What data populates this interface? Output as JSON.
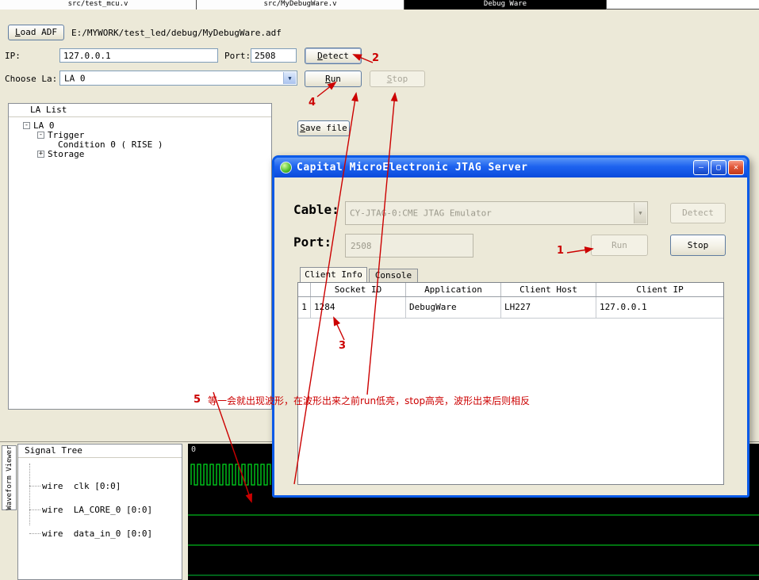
{
  "icons": {
    "collapse_glyph": "-",
    "expand_glyph": "+",
    "dropdown_arrow": "▼",
    "minimize_glyph": "—",
    "maximize_glyph": "▢",
    "close_glyph": "✕"
  },
  "colors": {
    "desktop_bg": "#ece9d8",
    "titlebar_blue": "#0a5ae8",
    "annotation_red": "#cc0000",
    "waveform_green": "#00d81f",
    "active_tab_bg": "#000000"
  },
  "editor_tabs": [
    {
      "label": "src/test_mcu.v",
      "active": false
    },
    {
      "label": "src/MyDebugWare.v",
      "active": false
    },
    {
      "label": "Debug Ware",
      "active": true
    }
  ],
  "main": {
    "load_adf_button": "Load ADF",
    "adf_path": "E:/MYWORK/test_led/debug/MyDebugWare.adf",
    "ip_label": "IP:",
    "ip_value": "127.0.0.1",
    "port_label": "Port:",
    "port_value": "2508",
    "detect_button": "Detect",
    "choose_la_label": "Choose La:",
    "choose_la_value": "LA 0",
    "run_button": "Run",
    "stop_button": "Stop",
    "save_file_button": "Save file",
    "la_list": {
      "title": "LA List",
      "items": [
        {
          "label": "LA 0"
        },
        {
          "label": "Trigger"
        },
        {
          "label": "Condition 0 ( RISE )"
        },
        {
          "label": "Storage"
        }
      ]
    }
  },
  "jtag_dialog": {
    "title": "Capital MicroElectronic JTAG Server",
    "cable_label": "Cable:",
    "cable_value": "CY-JTAG-0:CME JTAG Emulator",
    "detect_button": "Detect",
    "port_label": "Port:",
    "port_value": "2508",
    "run_button": "Run",
    "stop_button": "Stop",
    "tabs": [
      {
        "label": "Client Info",
        "active": true
      },
      {
        "label": "Console",
        "active": false
      }
    ],
    "client_table": {
      "headers": [
        "Socket ID",
        "Application",
        "Client Host",
        "Client IP"
      ],
      "rows": [
        {
          "num": "1",
          "socket_id": "1284",
          "application": "DebugWare",
          "client_host": "LH227",
          "client_ip": "127.0.0.1"
        }
      ]
    }
  },
  "waveform": {
    "viewer_tab": "Waveform Viewer",
    "signal_tree_title": "Signal Tree",
    "signals": [
      "wire  clk [0:0]",
      "wire  LA_CORE_0 [0:0]",
      "wire  data_in_0 [0:0]"
    ],
    "time_label": "0"
  },
  "annotations": {
    "step1": "1",
    "step2": "2",
    "step3": "3",
    "step4": "4",
    "step5": "5",
    "note": "等一会就出现波形，在波形出来之前run低亮，stop高亮，波形出来后则相反"
  }
}
